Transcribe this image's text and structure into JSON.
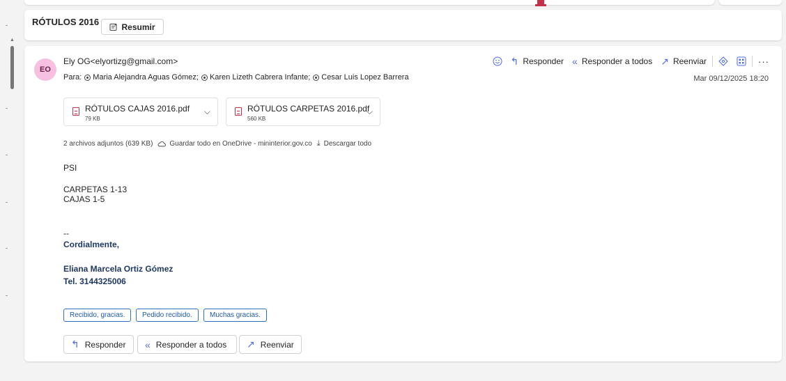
{
  "message": {
    "subject": "RÓTULOS 2016",
    "summary_label": "Resumir",
    "avatar_initials": "EO",
    "avatar_color": "#f7bfe0",
    "from": "Ely OG<elyortizg@gmail.com>",
    "to_label": "Para:",
    "recipients": [
      "Maria Alejandra Aguas Gómez;",
      "Karen Lizeth Cabrera Infante;",
      "Cesar Luis Lopez Barrera"
    ],
    "date": "Mar 09/12/2025 18:20",
    "actions": {
      "reply": "Responder",
      "reply_all": "Responder a todos",
      "forward": "Reenviar"
    }
  },
  "attachments": [
    {
      "name": "RÓTULOS CAJAS 2016.pdf",
      "size": "79 KB"
    },
    {
      "name": "RÓTULOS CARPETAS 2016.pdf",
      "size": "560 KB"
    }
  ],
  "attachment_info": {
    "count_text": "2 archivos adjuntos (639 KB)",
    "save_onedrive": "Guardar todo en OneDrive - mininterior.gov.co",
    "download_all": "Descargar todo"
  },
  "body": {
    "line1": "PSI",
    "line2": "CARPETAS 1-13",
    "line3": "CAJAS 1-5",
    "sig_sep": "--",
    "closing": "Cordialmente,",
    "sig_name": "Eliana Marcela Ortiz Gómez",
    "sig_phone": "Tel. 3144325006"
  },
  "quick_replies": [
    "Recibido, gracias.",
    "Pedido recibido.",
    "Muchas gracias."
  ],
  "footer": {
    "reply": "Responder",
    "reply_all": "Responder a todos",
    "forward": "Reenviar"
  },
  "colors": {
    "accent": "#4f6bed",
    "signature": "#1f3864",
    "quick_reply": "#1f5aa8",
    "pdf": "#c4314b"
  }
}
